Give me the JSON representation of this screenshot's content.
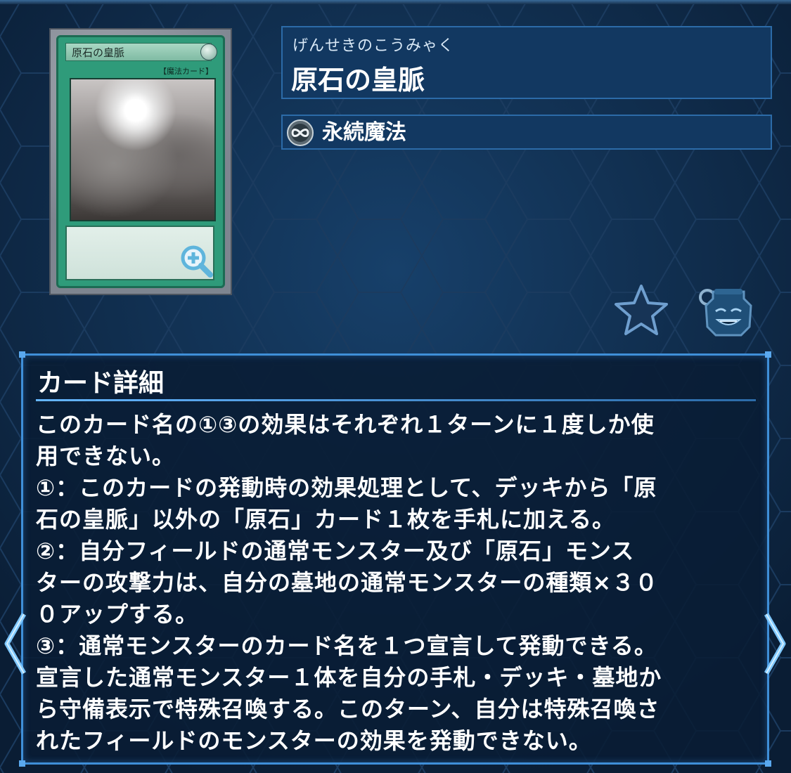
{
  "card": {
    "name_on_card": "原石の皇脈",
    "type_on_card": "【魔法カード】",
    "reading": "げんせきのこうみゃく",
    "name": "原石の皇脈",
    "spell_type": "永続魔法"
  },
  "icons": {
    "zoom": "zoom-in-icon",
    "spell_type": "continuous-spell-icon",
    "favorite": "star-icon",
    "deck_pot": "pot-of-greed-icon",
    "prev": "chevron-left-icon",
    "next": "chevron-right-icon"
  },
  "detail": {
    "title": "カード詳細",
    "lines": [
      "このカード名の①③の効果はそれぞれ１ターンに１度しか使",
      "用できない。",
      "①：このカードの発動時の効果処理として、デッキから「原",
      "石の皇脈」以外の「原石」カード１枚を手札に加える。",
      "②：自分フィールドの通常モンスター及び「原石」モンス",
      "ターの攻撃力は、自分の墓地の通常モンスターの種類×３０",
      "０アップする。",
      "③：通常モンスターのカード名を１つ宣言して発動できる。",
      "宣言した通常モンスター１体を自分の手札・デッキ・墓地か",
      "ら守備表示で特殊召喚する。このターン、自分は特殊召喚さ",
      "れたフィールドのモンスターの効果を発動できない。"
    ]
  },
  "colors": {
    "background": "#0d2440",
    "panel_border": "#3f8fd8",
    "card_green": "#2f9b7a"
  }
}
